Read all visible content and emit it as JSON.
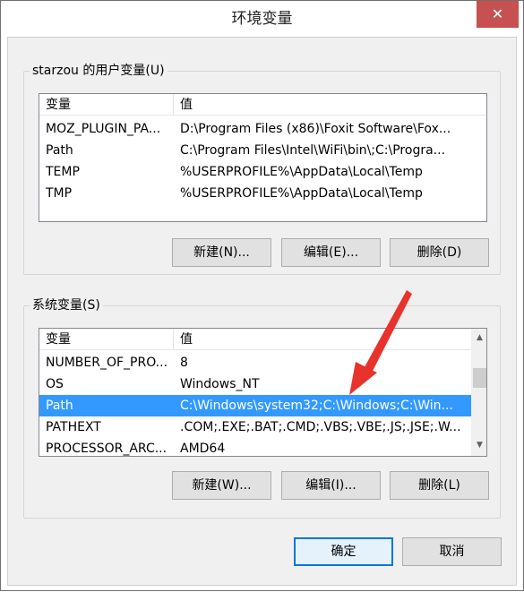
{
  "window": {
    "title": "环境变量",
    "close_glyph": "✕"
  },
  "user_group": {
    "legend": "starzou 的用户变量(U)",
    "columns": [
      "变量",
      "值"
    ],
    "rows": [
      {
        "name": "MOZ_PLUGIN_PA...",
        "value": "D:\\Program Files (x86)\\Foxit Software\\Fox..."
      },
      {
        "name": "Path",
        "value": "C:\\Program Files\\Intel\\WiFi\\bin\\;C:\\Progra..."
      },
      {
        "name": "TEMP",
        "value": "%USERPROFILE%\\AppData\\Local\\Temp"
      },
      {
        "name": "TMP",
        "value": "%USERPROFILE%\\AppData\\Local\\Temp"
      }
    ],
    "buttons": {
      "new": "新建(N)...",
      "edit": "编辑(E)...",
      "delete": "删除(D)"
    }
  },
  "system_group": {
    "legend": "系统变量(S)",
    "columns": [
      "变量",
      "值"
    ],
    "rows": [
      {
        "name": "NUMBER_OF_PRO...",
        "value": "8"
      },
      {
        "name": "OS",
        "value": "Windows_NT"
      },
      {
        "name": "Path",
        "value": "C:\\Windows\\system32;C:\\Windows;C:\\Win..."
      },
      {
        "name": "PATHEXT",
        "value": ".COM;.EXE;.BAT;.CMD;.VBS;.VBE;.JS;.JSE;.W..."
      },
      {
        "name": "PROCESSOR_ARC...",
        "value": "AMD64"
      }
    ],
    "selected_index": 2,
    "buttons": {
      "new": "新建(W)...",
      "edit": "编辑(I)...",
      "delete": "删除(L)"
    }
  },
  "footer": {
    "ok": "确定",
    "cancel": "取消"
  },
  "colors": {
    "selection": "#3399ff",
    "close_button": "#c75050",
    "annotation_arrow": "#e8322c"
  }
}
